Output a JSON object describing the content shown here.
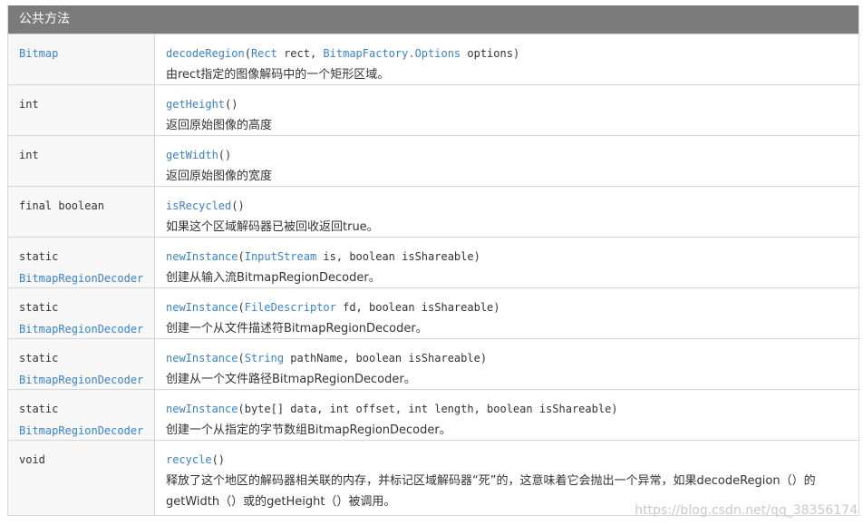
{
  "header": {
    "title": "公共方法"
  },
  "rows": [
    {
      "type_line1": "Bitmap",
      "type_line1_link": true,
      "type_line2": "",
      "method": "decodeRegion",
      "open": "(",
      "params": [
        {
          "t": "Rect",
          "link": true
        },
        {
          "t": " rect, ",
          "link": false
        },
        {
          "t": "BitmapFactory.Options",
          "link": true
        },
        {
          "t": " options)",
          "link": false
        }
      ],
      "desc": "由rect指定的图像解码中的一个矩形区域。"
    },
    {
      "type_line1": "int",
      "type_line1_link": false,
      "type_line2": "",
      "method": "getHeight",
      "open": "()",
      "params": [],
      "desc": "返回原始图像的高度"
    },
    {
      "type_line1": "int",
      "type_line1_link": false,
      "type_line2": "",
      "method": "getWidth",
      "open": "()",
      "params": [],
      "desc": "返回原始图像的宽度"
    },
    {
      "type_line1": "final boolean",
      "type_line1_link": false,
      "type_line2": "",
      "method": "isRecycled",
      "open": "()",
      "params": [],
      "desc": "如果这个区域解码器已被回收返回true。"
    },
    {
      "type_line1": "static",
      "type_line1_link": false,
      "type_line2": "BitmapRegionDecoder",
      "method": "newInstance",
      "open": "(",
      "params": [
        {
          "t": "InputStream",
          "link": true
        },
        {
          "t": " is, boolean isShareable)",
          "link": false
        }
      ],
      "desc": "创建从输入流BitmapRegionDecoder。"
    },
    {
      "type_line1": "static",
      "type_line1_link": false,
      "type_line2": "BitmapRegionDecoder",
      "method": "newInstance",
      "open": "(",
      "params": [
        {
          "t": "FileDescriptor",
          "link": true
        },
        {
          "t": " fd, boolean isShareable)",
          "link": false
        }
      ],
      "desc": "创建一个从文件描述符BitmapRegionDecoder。"
    },
    {
      "type_line1": "static",
      "type_line1_link": false,
      "type_line2": "BitmapRegionDecoder",
      "method": "newInstance",
      "open": "(",
      "params": [
        {
          "t": "String",
          "link": true
        },
        {
          "t": " pathName, boolean isShareable)",
          "link": false
        }
      ],
      "desc": "创建从一个文件路径BitmapRegionDecoder。"
    },
    {
      "type_line1": "static",
      "type_line1_link": false,
      "type_line2": "BitmapRegionDecoder",
      "method": "newInstance",
      "open": "(",
      "params": [
        {
          "t": "byte[] data, int offset, int length, boolean isShareable)",
          "link": false
        }
      ],
      "desc": "创建一个从指定的字节数组BitmapRegionDecoder。"
    },
    {
      "type_line1": "void",
      "type_line1_link": false,
      "type_line2": "",
      "method": "recycle",
      "open": "()",
      "params": [],
      "desc": "释放了这个地区的解码器相关联的内存，并标记区域解码器“死”的，这意味着它会抛出一个异常，如果decodeRegion（）的getWidth（）或的getHeight（）被调用。"
    }
  ],
  "watermark": "https://blog.csdn.net/qq_38356174"
}
